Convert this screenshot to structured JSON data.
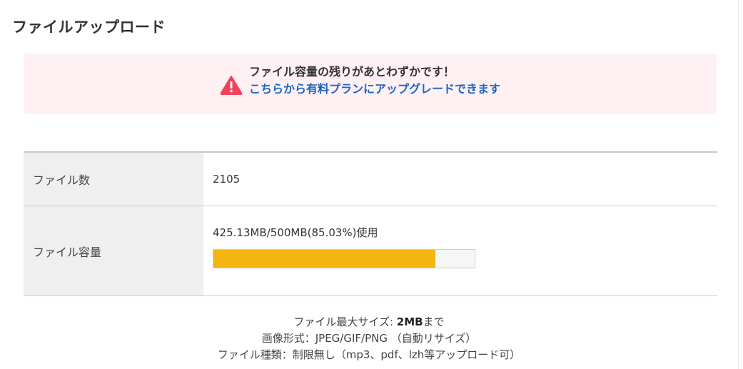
{
  "page": {
    "title": "ファイルアップロード"
  },
  "alert": {
    "icon": "warning-triangle-icon",
    "message": "ファイル容量の残りがあとわずかです！",
    "link_text": "こちらから有料プランにアップグレードできます",
    "colors": {
      "background": "#fff0f4",
      "icon": "#f0435a",
      "link": "#1a66c2"
    }
  },
  "stats": {
    "file_count": {
      "label": "ファイル数",
      "value": "2105"
    },
    "file_capacity": {
      "label": "ファイル容量",
      "usage_text": "425.13MB/500MB(85.03%)使用",
      "used_fraction": 0.8503,
      "bar_color": "#f3b60f"
    }
  },
  "footer": {
    "max_size_prefix": "ファイル最大サイズ: ",
    "max_size_value": "2MB",
    "max_size_suffix": "まで",
    "image_format": "画像形式：JPEG/GIF/PNG （自動リサイズ）",
    "file_types": "ファイル種類：制限無し（mp3、pdf、lzh等アップロード可）"
  }
}
